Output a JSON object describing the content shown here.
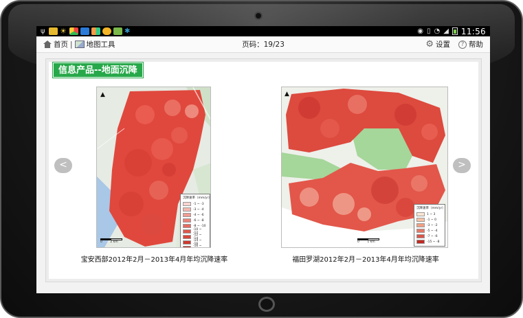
{
  "statusbar": {
    "icons": [
      "usb-icon",
      "app-icon",
      "sun-icon",
      "chrome-icon",
      "app-icon",
      "photos-icon",
      "cloud-icon",
      "tv-icon",
      "app-icon"
    ],
    "right_icons": [
      "eye-icon",
      "vibrate-icon",
      "wifi-icon",
      "signal-icon",
      "battery-icon"
    ],
    "time": "11:56"
  },
  "toolbar": {
    "home_label": "首页",
    "separator": "|",
    "tools_label": "地图工具",
    "page_label": "页码：19/23",
    "settings_label": "设置",
    "help_label": "帮助"
  },
  "section": {
    "title": "信息产品--地面沉降"
  },
  "maps": [
    {
      "caption": "宝安西部2012年2月－2013年4月年均沉降速率",
      "legend_title": "沉降速率（mm/yr）",
      "legend": [
        "-1 ~ -3",
        "-3 ~ -4",
        "-4 ~ -6",
        "-6 ~ -8",
        "-8 ~ -10",
        "-10 ~ -12",
        "-12 ~ -14",
        "-14 ~ -16",
        "-16 ~ -18"
      ],
      "legend_colors": [
        "#f8d4d0",
        "#f4b8b0",
        "#f09c92",
        "#ec8478",
        "#e56c60",
        "#df574c",
        "#d9473c",
        "#cf3a30",
        "#c22a22"
      ],
      "scale": [
        "0",
        "2",
        "km"
      ]
    },
    {
      "caption": "福田罗湖2012年2月－2013年4月年均沉降速率",
      "legend_title": "沉降速率（mm/yr）",
      "legend": [
        "1 ~ 3",
        "-1 ~ 0",
        "-3 ~ -2",
        "-5 ~ -4",
        "-7 ~ -6",
        "-15 ~ -8"
      ],
      "legend_colors": [
        "#fbe5d2",
        "#f6c2a4",
        "#f0a184",
        "#e57866",
        "#d8554a",
        "#c22a22"
      ],
      "scale": [
        "0",
        "1",
        "km"
      ]
    }
  ],
  "nav": {
    "prev_label": "<",
    "next_label": ">"
  },
  "colors": {
    "accent": "#27a84a",
    "subsidence": "#e0483d"
  }
}
